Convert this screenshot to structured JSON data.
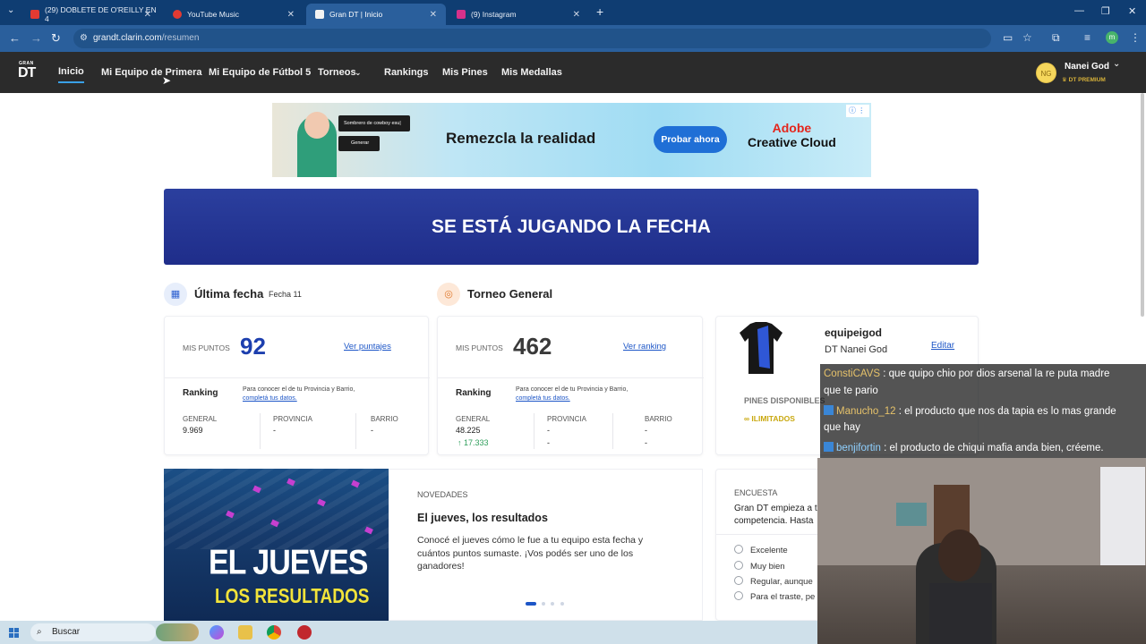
{
  "browser": {
    "tabs": [
      {
        "title": "(29) DOBLETE DE O'REILLY EN 4",
        "fav": "#e23a32"
      },
      {
        "title": "YouTube Music",
        "fav": "#e23a32"
      },
      {
        "title": "Gran DT | Inicio",
        "fav": "#f2f2f2"
      },
      {
        "title": "(9) Instagram",
        "fav": "#d6318b"
      }
    ],
    "url_host": "grandt.clarin.com",
    "url_path": "/resumen",
    "profile_initial": "m"
  },
  "site": {
    "logo_top": "GRAN",
    "logo_main": "DT",
    "nav": [
      "Inicio",
      "Mi Equipo de Primera",
      "Mi Equipo de Fútbol 5",
      "Torneos",
      "Rankings",
      "Mis Pines",
      "Mis Medallas"
    ],
    "user": {
      "initials": "NG",
      "name": "Nanei God",
      "tier": "DT PREMIUM"
    }
  },
  "ad": {
    "prompt": "Sombrero de cowboy esu|",
    "generate": "Generar",
    "headline": "Remezcla la realidad",
    "cta": "Probar ahora",
    "brand_line1": "Adobe",
    "brand_line2": "Creative Cloud"
  },
  "banner": {
    "text": "SE ESTÁ JUGANDO LA FECHA"
  },
  "ultima": {
    "title": "Última fecha",
    "fecha": "Fecha 11",
    "label": "MIS PUNTOS",
    "points": "92",
    "link": "Ver puntajes",
    "ranking": "Ranking",
    "hint1": "Para conocer el de tu Provincia y Barrio,",
    "hint2": "completá tus datos.",
    "cols": [
      "GENERAL",
      "PROVINCIA",
      "BARRIO"
    ],
    "vals": [
      "9.969",
      "-",
      "-"
    ]
  },
  "torneo": {
    "title": "Torneo General",
    "label": "MIS PUNTOS",
    "points": "462",
    "link": "Ver ranking",
    "ranking": "Ranking",
    "hint1": "Para conocer el de tu Provincia y Barrio,",
    "hint2": "completá tus datos.",
    "cols": [
      "GENERAL",
      "PROVINCIA",
      "BARRIO"
    ],
    "vals": [
      "48.225",
      "-",
      "-"
    ],
    "vals2": [
      "17.333",
      "-",
      "-"
    ]
  },
  "team": {
    "name": "equipeigod",
    "dt": "DT Nanei God",
    "edit": "Editar",
    "pins_label": "PINES DISPONIBLES",
    "pins_value": "ILIMITADOS"
  },
  "news": {
    "section": "NOVEDADES",
    "title": "El jueves, los resultados",
    "body": "Conocé el jueves cómo le fue a tu equipo esta fecha y cuántos puntos sumaste. ¡Vos podés ser uno de los ganadores!",
    "promo_line1": "EL JUEVES",
    "promo_line2": "LOS RESULTADOS"
  },
  "survey": {
    "section": "ENCUESTA",
    "q1": "Gran DT empieza a tr",
    "q2": "competencia. Hasta",
    "options": [
      "Excelente",
      "Muy bien",
      "Regular, aunque",
      "Para el traste, pe"
    ]
  },
  "chat": [
    {
      "user": "ConstiCAVS",
      "msg": " : que quipo chio por dios arsenal la re puta madre"
    },
    {
      "user": "",
      "msg": "que te pario"
    },
    {
      "user": "Manucho_12",
      "msg": " : el producto que nos da tapia es lo mas grande"
    },
    {
      "user": "",
      "msg": "que hay"
    },
    {
      "user": "benjifortin",
      "msg": " : el producto de chiqui mafia anda bien, créeme."
    }
  ],
  "taskbar": {
    "search": "Buscar"
  }
}
